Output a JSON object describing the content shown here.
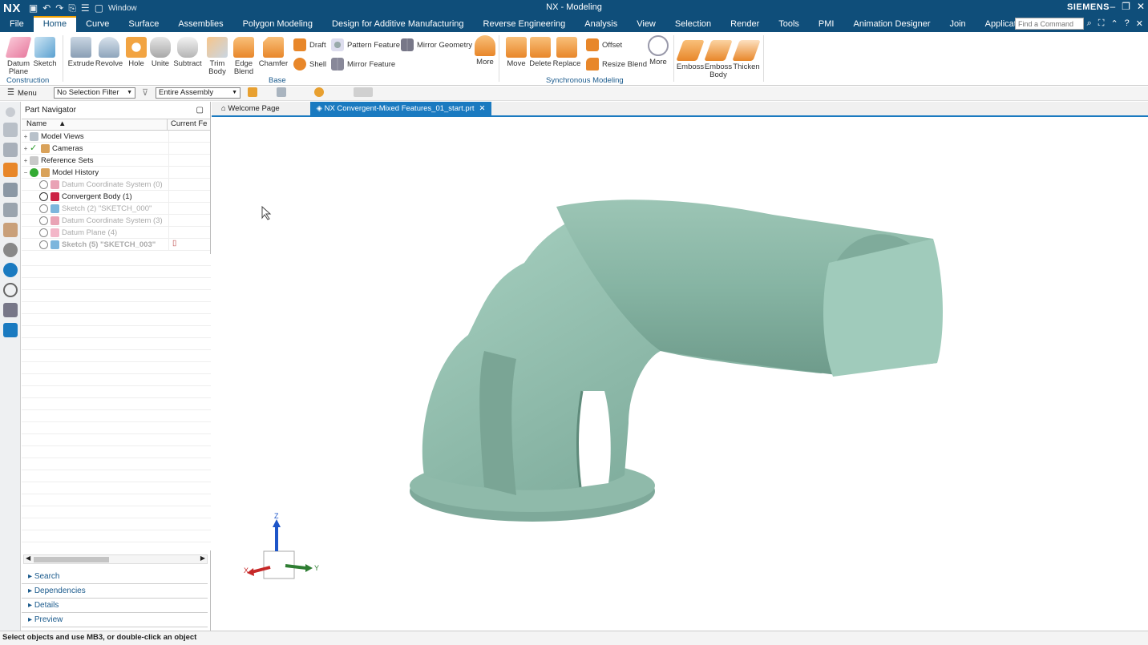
{
  "app": {
    "logo": "NX",
    "title": "NX - Modeling",
    "brand": "SIEMENS",
    "window_menu": "Window"
  },
  "menu_tabs": [
    "File",
    "Home",
    "Curve",
    "Surface",
    "Assemblies",
    "Polygon Modeling",
    "Design for Additive Manufacturing",
    "Reverse Engineering",
    "Analysis",
    "View",
    "Selection",
    "Render",
    "Tools",
    "PMI",
    "Animation Designer",
    "Join",
    "Application"
  ],
  "find_command": {
    "placeholder": "Find a Command"
  },
  "ribbon": {
    "datum_plane": "Datum Plane",
    "sketch": "Sketch",
    "construction": "Construction",
    "extrude": "Extrude",
    "revolve": "Revolve",
    "hole": "Hole",
    "unite": "Unite",
    "subtract": "Subtract",
    "trim_body": "Trim Body",
    "edge_blend": "Edge Blend",
    "chamfer": "Chamfer",
    "draft": "Draft",
    "shell": "Shell",
    "pattern_feature": "Pattern Feature",
    "mirror_feature": "Mirror Feature",
    "mirror_geometry": "Mirror Geometry",
    "more1": "More",
    "base": "Base",
    "move": "Move",
    "delete": "Delete",
    "replace": "Replace",
    "offset": "Offset",
    "resize_blend": "Resize Blend",
    "more2": "More",
    "sync": "Synchronous Modeling",
    "emboss": "Emboss",
    "emboss_body": "Emboss Body",
    "thicken": "Thicken"
  },
  "toolbar": {
    "menu": "Menu",
    "filter": "No Selection Filter",
    "scope": "Entire Assembly"
  },
  "navigator": {
    "title": "Part Navigator",
    "col_name": "Name",
    "col_current": "Current Fe",
    "rows": [
      {
        "label": "Model Views",
        "indent": 0,
        "dim": false
      },
      {
        "label": "Cameras",
        "indent": 0,
        "dim": false
      },
      {
        "label": "Reference Sets",
        "indent": 0,
        "dim": false
      },
      {
        "label": "Model History",
        "indent": 0,
        "dim": false
      },
      {
        "label": "Datum Coordinate System (0)",
        "indent": 1,
        "dim": true
      },
      {
        "label": "Convergent Body (1)",
        "indent": 1,
        "dim": false
      },
      {
        "label": "Sketch (2) \"SKETCH_000\"",
        "indent": 1,
        "dim": true
      },
      {
        "label": "Datum Coordinate System (3)",
        "indent": 1,
        "dim": true
      },
      {
        "label": "Datum Plane (4)",
        "indent": 1,
        "dim": true
      },
      {
        "label": "Sketch (5) \"SKETCH_003\"",
        "indent": 1,
        "dim": true
      }
    ],
    "accordion": [
      "Search",
      "Dependencies",
      "Details",
      "Preview"
    ]
  },
  "doc_tabs": {
    "welcome": "Welcome Page",
    "active": "NX Convergent-Mixed Features_01_start.prt"
  },
  "triad": {
    "z": "Z",
    "x": "X",
    "y": "Y"
  },
  "status": "Select objects and use MB3, or double-click an object",
  "colors": {
    "titlebar": "#0f4e7a",
    "accent": "#1a7ac0",
    "part": "#8fbfae"
  }
}
